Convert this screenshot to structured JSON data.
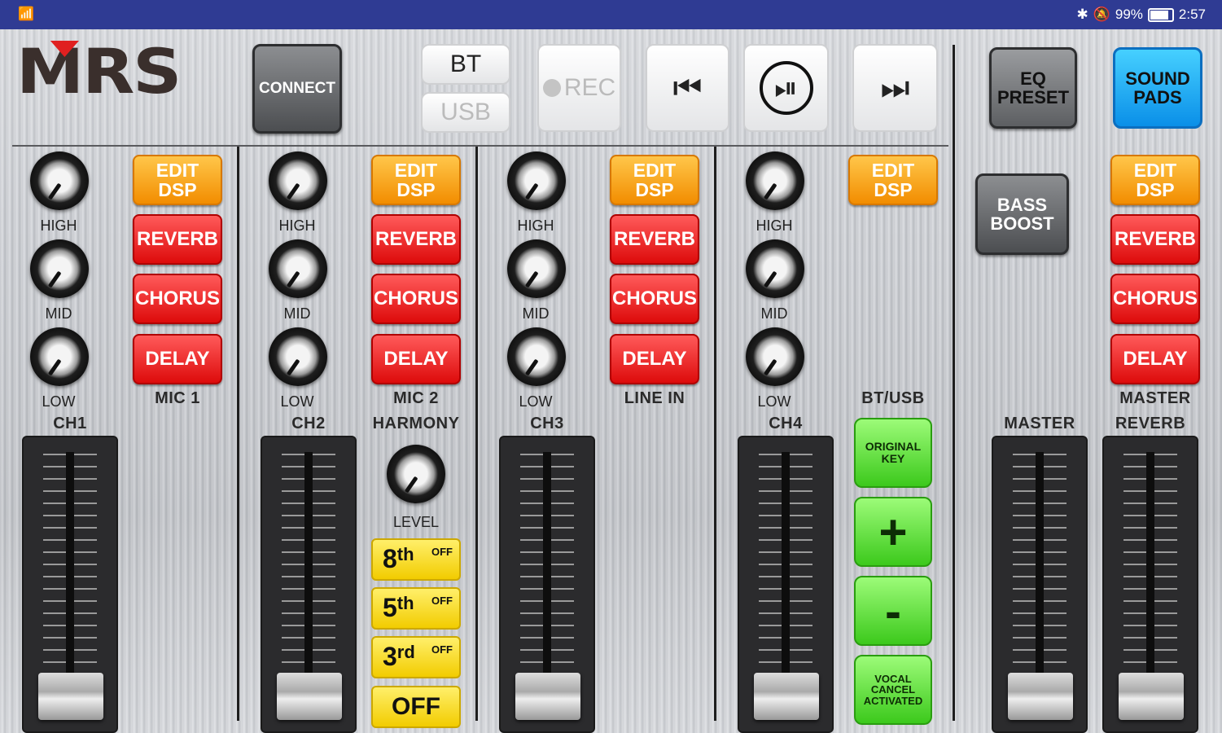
{
  "status": {
    "battery": "99%",
    "time": "2:57",
    "battery_level": 0.99
  },
  "logo": "MRS",
  "toolbar": {
    "connect": "CONNECT",
    "bt": "BT",
    "usb": "USB",
    "rec": "REC",
    "eq_preset": [
      "EQ",
      "PRESET"
    ],
    "sound_pads": [
      "SOUND",
      "PADS"
    ]
  },
  "eq_labels": {
    "high": "HIGH",
    "mid": "MID",
    "low": "LOW"
  },
  "fx": {
    "edit_dsp": [
      "EDIT",
      "DSP"
    ],
    "reverb": "REVERB",
    "chorus": "CHORUS",
    "delay": "DELAY"
  },
  "channels": [
    {
      "name": "CH1",
      "source": "MIC 1"
    },
    {
      "name": "CH2",
      "source": "MIC 2"
    },
    {
      "name": "CH3",
      "source": "LINE IN"
    },
    {
      "name": "CH4",
      "source": "BT/USB"
    }
  ],
  "harmony": {
    "title": "HARMONY",
    "level": "LEVEL",
    "options": [
      {
        "num": "8",
        "suffix": "th",
        "state": "OFF"
      },
      {
        "num": "5",
        "suffix": "th",
        "state": "OFF"
      },
      {
        "num": "3",
        "suffix": "rd",
        "state": "OFF"
      }
    ],
    "off": "OFF"
  },
  "key": {
    "original": [
      "ORIGINAL",
      "KEY"
    ],
    "plus": "+",
    "minus": "-",
    "vocal_cancel": [
      "VOCAL",
      "CANCEL",
      "ACTIVATED"
    ]
  },
  "master": {
    "bass_boost": [
      "BASS",
      "BOOST"
    ],
    "master_label": "MASTER",
    "master_fader": "MASTER",
    "reverb_fader": "REVERB"
  }
}
